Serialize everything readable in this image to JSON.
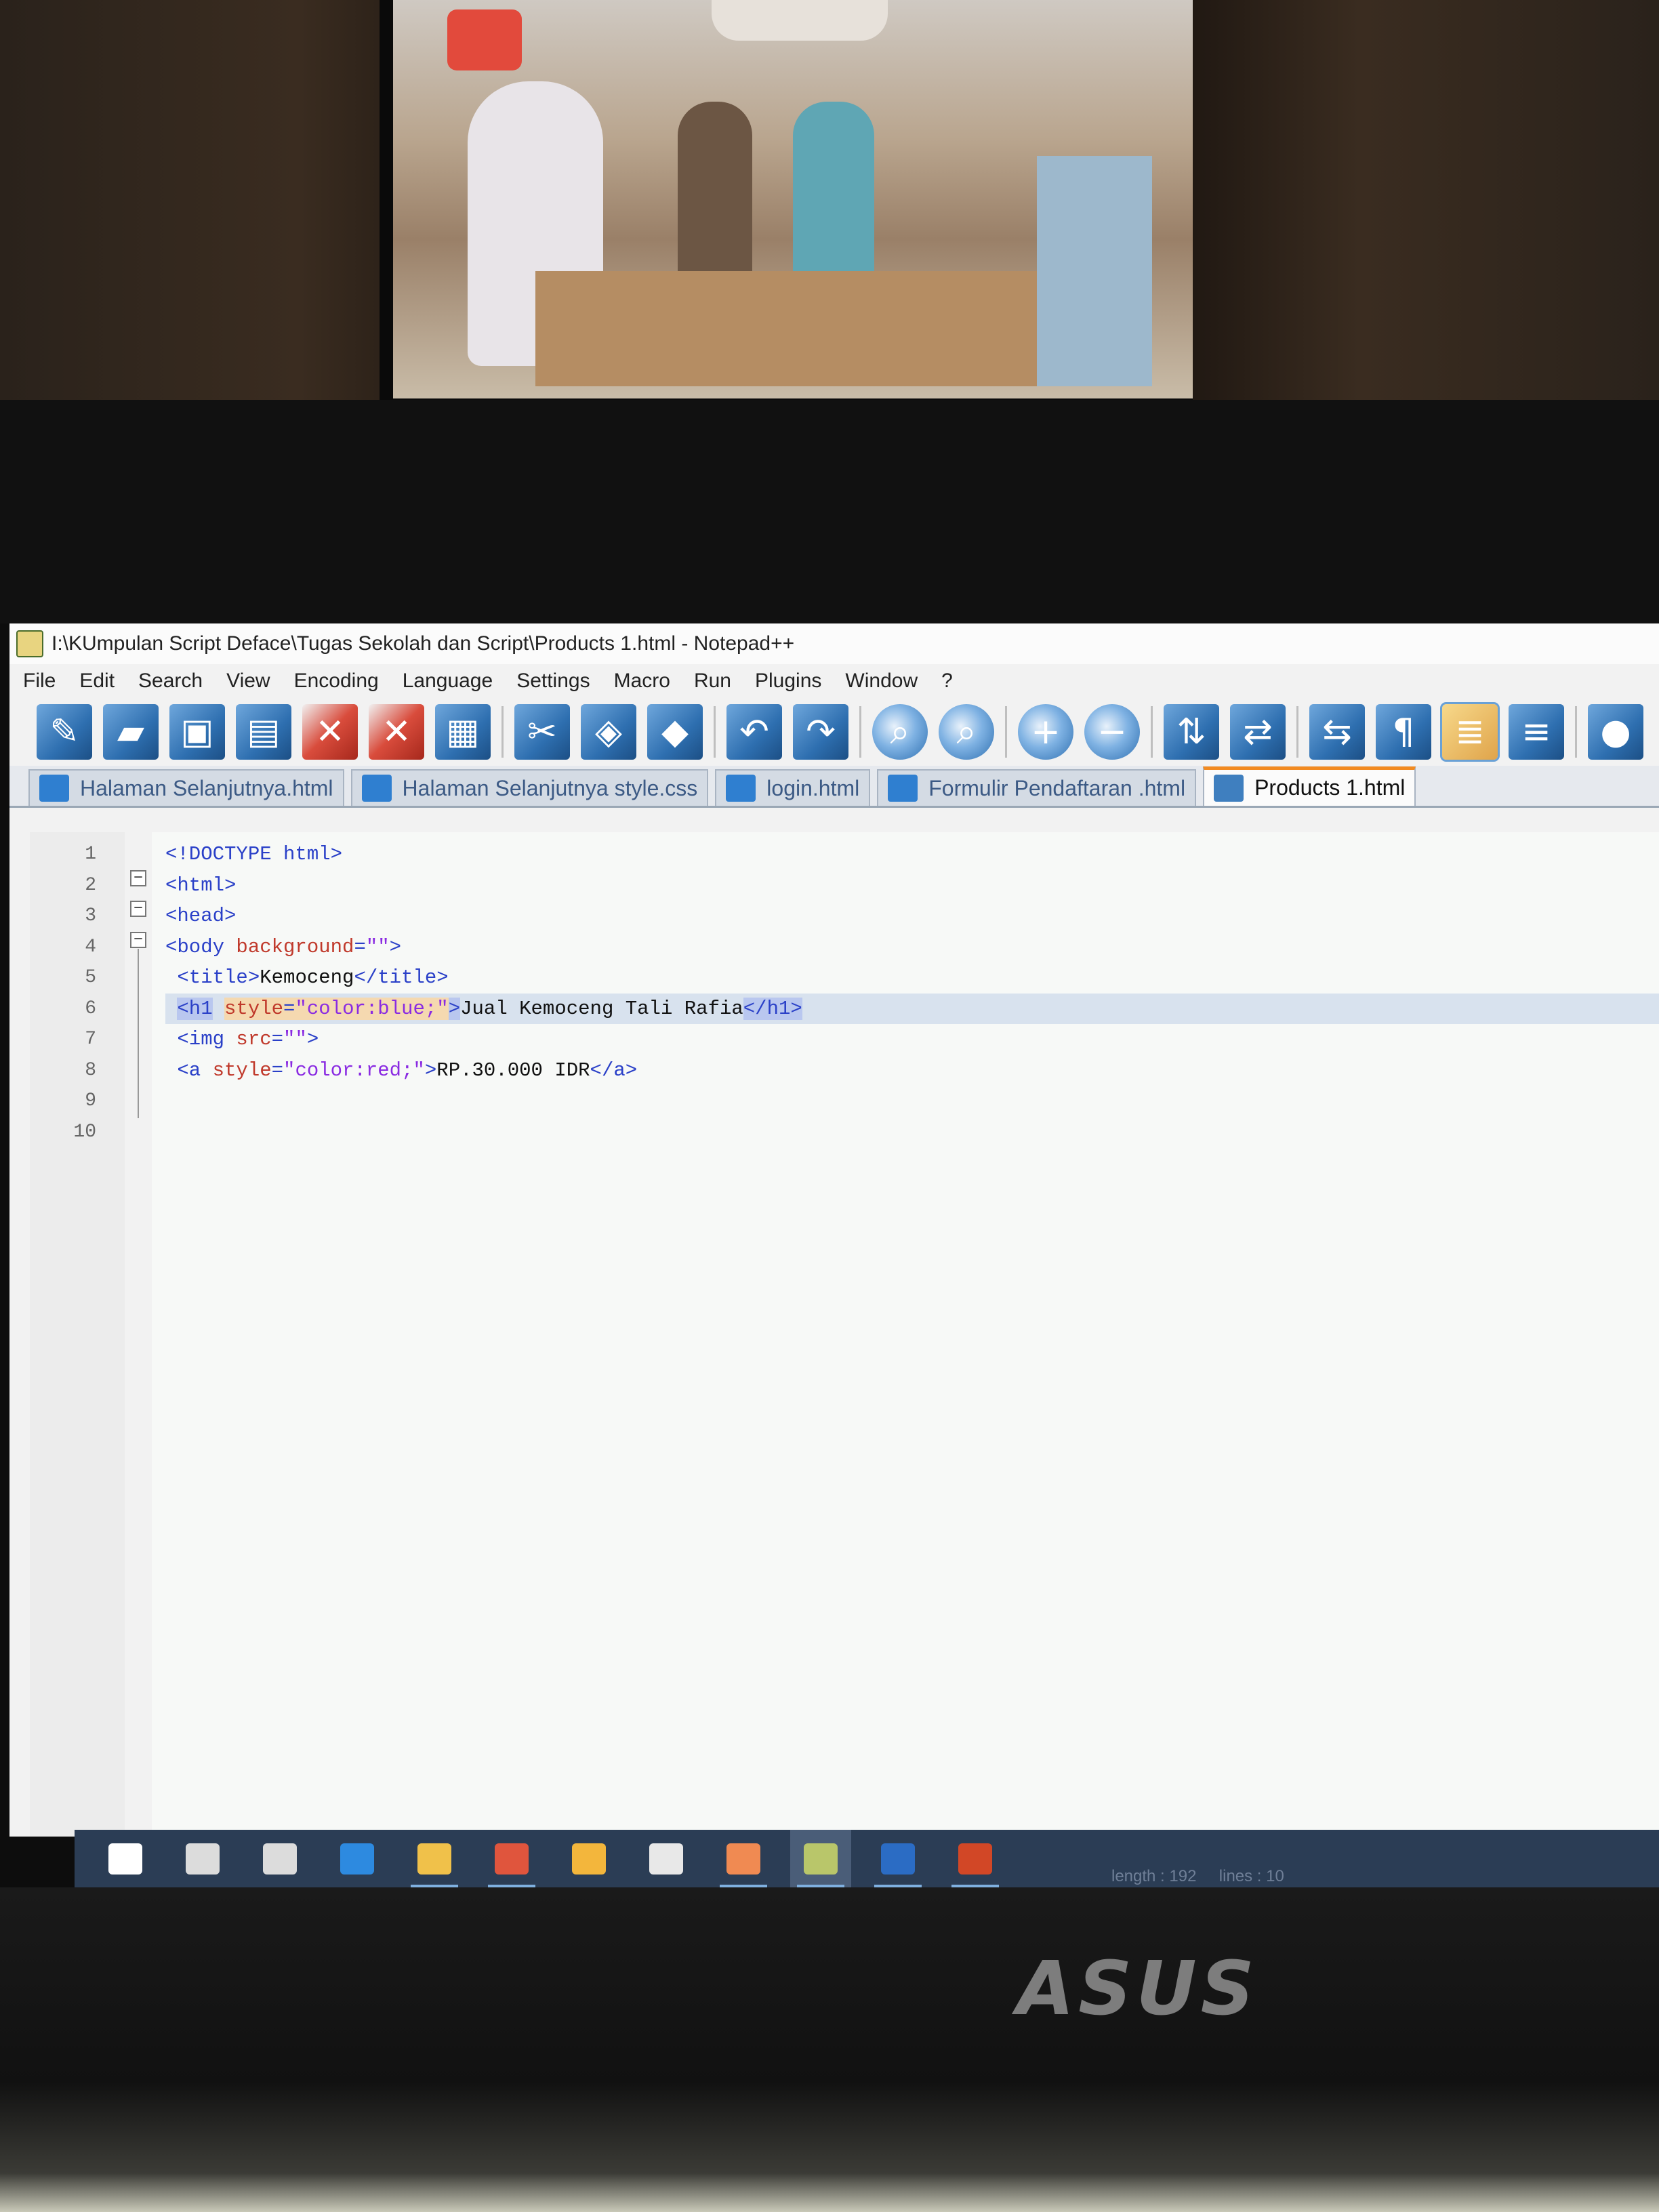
{
  "window": {
    "title": "I:\\KUmpulan Script Deface\\Tugas Sekolah dan Script\\Products 1.html - Notepad++"
  },
  "menu": [
    "File",
    "Edit",
    "Search",
    "View",
    "Encoding",
    "Language",
    "Settings",
    "Macro",
    "Run",
    "Plugins",
    "Window",
    "?"
  ],
  "toolbar": [
    {
      "name": "new-file-icon",
      "glyph": "✎",
      "style": ""
    },
    {
      "name": "open-file-icon",
      "glyph": "▰",
      "style": ""
    },
    {
      "name": "save-icon",
      "glyph": "▣",
      "style": ""
    },
    {
      "name": "save-all-icon",
      "glyph": "▤",
      "style": ""
    },
    {
      "name": "close-icon",
      "glyph": "✕",
      "style": "red"
    },
    {
      "name": "close-all-icon",
      "glyph": "✕",
      "style": "red"
    },
    {
      "name": "print-icon",
      "glyph": "▦",
      "style": ""
    },
    {
      "sep": true
    },
    {
      "name": "cut-icon",
      "glyph": "✂",
      "style": ""
    },
    {
      "name": "copy-icon",
      "glyph": "◈",
      "style": ""
    },
    {
      "name": "paste-icon",
      "glyph": "◆",
      "style": ""
    },
    {
      "sep": true
    },
    {
      "name": "undo-icon",
      "glyph": "↶",
      "style": ""
    },
    {
      "name": "redo-icon",
      "glyph": "↷",
      "style": ""
    },
    {
      "sep": true
    },
    {
      "name": "find-icon",
      "glyph": "⌕",
      "style": "glass"
    },
    {
      "name": "replace-icon",
      "glyph": "⌕",
      "style": "glass"
    },
    {
      "sep": true
    },
    {
      "name": "zoom-in-icon",
      "glyph": "+",
      "style": "glass"
    },
    {
      "name": "zoom-out-icon",
      "glyph": "−",
      "style": "glass"
    },
    {
      "sep": true
    },
    {
      "name": "sync-vertical-icon",
      "glyph": "⇅",
      "style": ""
    },
    {
      "name": "sync-horizontal-icon",
      "glyph": "⇄",
      "style": ""
    },
    {
      "sep": true
    },
    {
      "name": "word-wrap-icon",
      "glyph": "⇆",
      "style": ""
    },
    {
      "name": "show-all-characters-icon",
      "glyph": "¶",
      "style": ""
    },
    {
      "name": "indent-guide-icon",
      "glyph": "≣",
      "style": "active"
    },
    {
      "name": "language-icon",
      "glyph": "≡",
      "style": ""
    },
    {
      "sep": true
    },
    {
      "name": "record-macro-icon",
      "glyph": "●",
      "style": ""
    }
  ],
  "tabs": [
    {
      "label": "Halaman Selanjutnya.html",
      "active": false
    },
    {
      "label": "Halaman Selanjutnya style.css",
      "active": false
    },
    {
      "label": "login.html",
      "active": false
    },
    {
      "label": "Formulir Pendaftaran .html",
      "active": false
    },
    {
      "label": "Products 1.html",
      "active": true
    }
  ],
  "editor": {
    "line_numbers": [
      "1",
      "2",
      "3",
      "4",
      "5",
      "6",
      "7",
      "8",
      "9",
      "10"
    ],
    "current_line": 6,
    "lines": [
      [
        {
          "t": "<!DOCTYPE html>",
          "c": "tag"
        }
      ],
      [
        {
          "t": "<html>",
          "c": "tag"
        }
      ],
      [
        {
          "t": "<head>",
          "c": "tag"
        }
      ],
      [
        {
          "t": "<body ",
          "c": "tag"
        },
        {
          "t": "background",
          "c": "attr"
        },
        {
          "t": "=",
          "c": "tag"
        },
        {
          "t": "\"\"",
          "c": "val"
        },
        {
          "t": ">",
          "c": "tag"
        }
      ],
      [
        {
          "t": " <title>",
          "c": "tag"
        },
        {
          "t": "Kemoceng",
          "c": ""
        },
        {
          "t": "</title>",
          "c": "tag"
        }
      ],
      [
        {
          "t": " ",
          "c": ""
        },
        {
          "t": "<h1",
          "c": "tag hl"
        },
        {
          "t": " ",
          "c": ""
        },
        {
          "t": "style",
          "c": "attr hl2"
        },
        {
          "t": "=",
          "c": "tag hl2"
        },
        {
          "t": "\"color:blue;\"",
          "c": "val hl2"
        },
        {
          "t": ">",
          "c": "tag hl"
        },
        {
          "t": "Jual Kemoceng Tali Rafia",
          "c": ""
        },
        {
          "t": "</h1>",
          "c": "tag hl"
        }
      ],
      [
        {
          "t": " <img ",
          "c": "tag"
        },
        {
          "t": "src",
          "c": "attr"
        },
        {
          "t": "=",
          "c": "tag"
        },
        {
          "t": "\"\"",
          "c": "val"
        },
        {
          "t": ">",
          "c": "tag"
        }
      ],
      [
        {
          "t": " <a ",
          "c": "tag"
        },
        {
          "t": "style",
          "c": "attr"
        },
        {
          "t": "=",
          "c": "tag"
        },
        {
          "t": "\"color:red;\"",
          "c": "val"
        },
        {
          "t": ">",
          "c": "tag"
        },
        {
          "t": "RP.30.000 IDR",
          "c": ""
        },
        {
          "t": "</a>",
          "c": "tag"
        }
      ],
      [],
      []
    ]
  },
  "status": {
    "length": "length : 192",
    "lines": "lines : 10"
  },
  "taskbar": [
    {
      "name": "start-icon",
      "color": "#ffffff",
      "open": false,
      "active": false
    },
    {
      "name": "search-icon",
      "color": "#dcdcdc",
      "open": false,
      "active": false
    },
    {
      "name": "task-view-icon",
      "color": "#dcdcdc",
      "open": false,
      "active": false
    },
    {
      "name": "edge-icon",
      "color": "#2d8ae0",
      "open": false,
      "active": false
    },
    {
      "name": "file-explorer-icon",
      "color": "#f0c14a",
      "open": true,
      "active": false
    },
    {
      "name": "chrome-icon",
      "color": "#e0553d",
      "open": true,
      "active": false
    },
    {
      "name": "store-icon",
      "color": "#f3b63c",
      "open": false,
      "active": false
    },
    {
      "name": "mail-icon",
      "color": "#e8e8e8",
      "open": false,
      "active": false
    },
    {
      "name": "xampp-icon",
      "color": "#f08a52",
      "open": true,
      "active": false
    },
    {
      "name": "notepad-plus-plus-icon",
      "color": "#b9c66a",
      "open": true,
      "active": true
    },
    {
      "name": "word-icon",
      "color": "#2b6cc4",
      "open": true,
      "active": false
    },
    {
      "name": "powerpoint-icon",
      "color": "#d24726",
      "open": true,
      "active": false
    }
  ],
  "brand": "ASUS"
}
